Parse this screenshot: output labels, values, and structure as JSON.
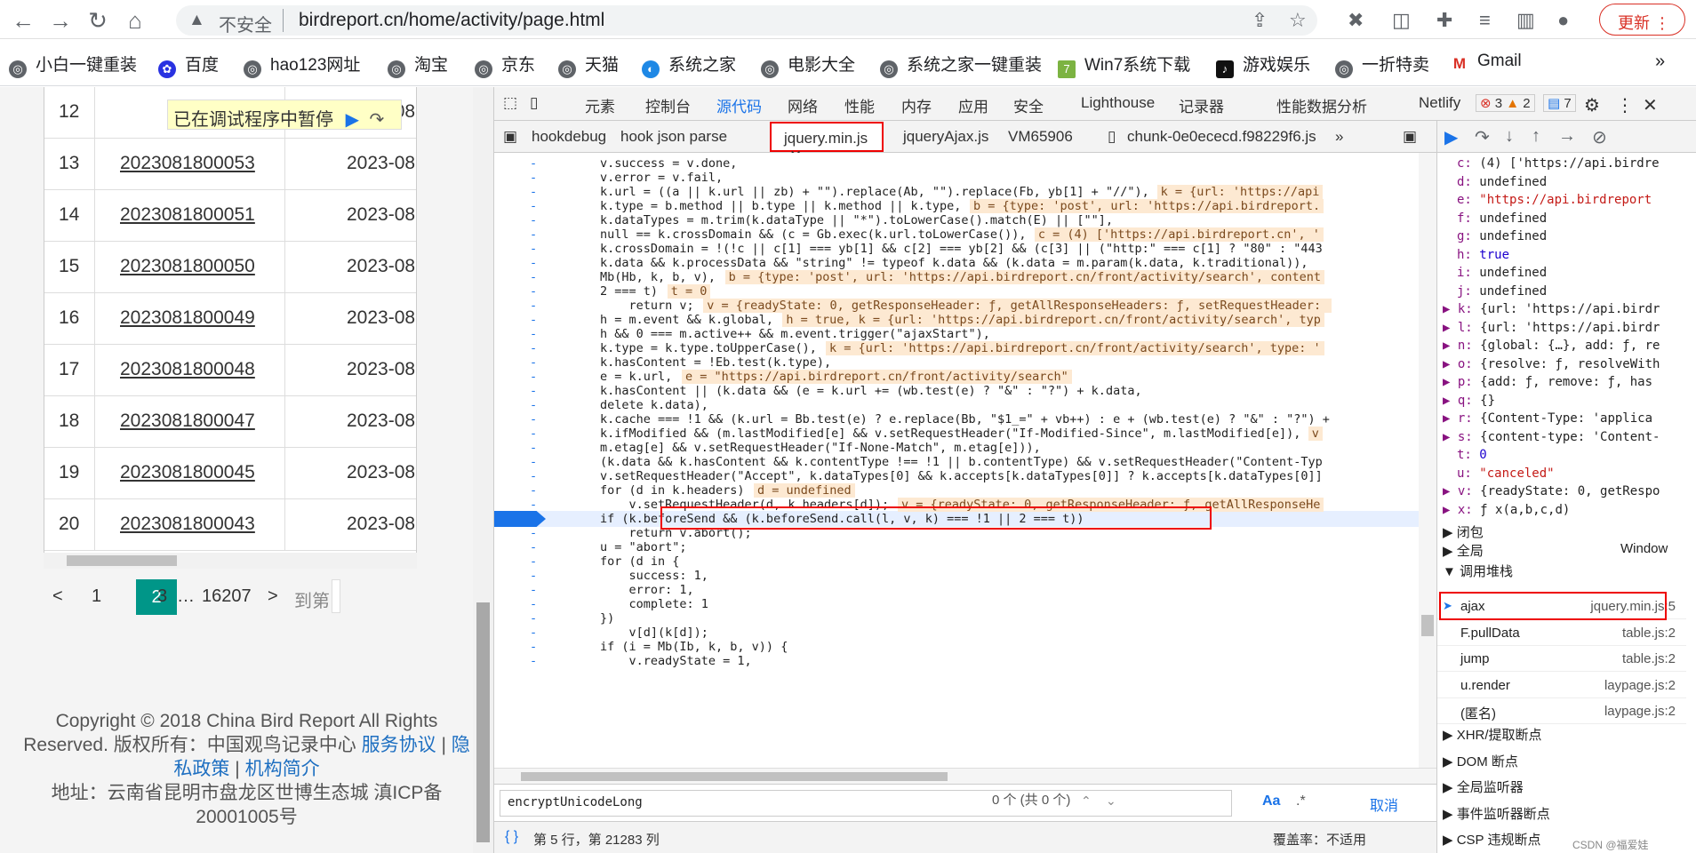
{
  "browser": {
    "url_insecure": "不安全",
    "url": "birdreport.cn/home/activity/page.html",
    "update_label": "更新"
  },
  "bookmarks": [
    "小白一键重装",
    "百度",
    "hao123网址",
    "淘宝",
    "京东",
    "天猫",
    "系统之家",
    "电影大全",
    "系统之家一键重装",
    "Win7系统下载",
    "游戏娱乐",
    "一折特卖",
    "Gmail"
  ],
  "page": {
    "paused_banner": "已在调试程序中暂停",
    "rows": [
      {
        "num": "12",
        "id": "",
        "date": "2023-08"
      },
      {
        "num": "13",
        "id": "2023081800053",
        "date": "2023-08"
      },
      {
        "num": "14",
        "id": "2023081800051",
        "date": "2023-08"
      },
      {
        "num": "15",
        "id": "2023081800050",
        "date": "2023-08"
      },
      {
        "num": "16",
        "id": "2023081800049",
        "date": "2023-08"
      },
      {
        "num": "17",
        "id": "2023081800048",
        "date": "2023-08"
      },
      {
        "num": "18",
        "id": "2023081800047",
        "date": "2023-08"
      },
      {
        "num": "19",
        "id": "2023081800045",
        "date": "2023-08"
      },
      {
        "num": "20",
        "id": "2023081800043",
        "date": "2023-08"
      }
    ],
    "pager": {
      "prev": "<",
      "p1": "1",
      "current": "2",
      "p3": "3",
      "ellipsis": "…",
      "last": "16207",
      "next": ">",
      "goto": "到第"
    },
    "footer": {
      "line1": "Copyright © 2018 China Bird Report All Rights",
      "line2a": "Reserved.   版权所有：中国观鸟记录中心",
      "link1": "服务协议",
      "sep": "|",
      "link2": "隐",
      "link2b": "私政策",
      "link3": "机构简介",
      "line3": "地址：云南省昆明市盘龙区世博生态城     滇ICP备",
      "line4": "20001005号"
    }
  },
  "devtools": {
    "tabs": [
      "元素",
      "控制台",
      "源代码",
      "网络",
      "性能",
      "内存",
      "应用",
      "安全",
      "Lighthouse",
      "记录器",
      "性能数据分析",
      "Netlify"
    ],
    "errors": "3",
    "warnings": "2",
    "messages": "7",
    "source_tabs": [
      "hookdebug",
      "hook json parse",
      "jquery.min.js",
      "jqueryAjax.js",
      "VM65906",
      "chunk-0e0ececd.f98229f6.js"
    ],
    "code_lines": [
      "v.success = v.done,",
      "v.error = v.fail,",
      "k.url = ((a || k.url || zb) + \"\").replace(Ab, \"\").replace(Fb, yb[1] + \"//\"),",
      "k.type = b.method || b.type || k.method || k.type,",
      "k.dataTypes = m.trim(k.dataType || \"*\").toLowerCase().match(E) || [\"\"],",
      "null == k.crossDomain && (c = Gb.exec(k.url.toLowerCase()),",
      "k.crossDomain = !(!c || c[1] === yb[1] && c[2] === yb[2] && (c[3] || (\"http:\" === c[1] ? \"80\" : \"443",
      "k.data && k.processData && \"string\" != typeof k.data && (k.data = m.param(k.data, k.traditional)),",
      "Mb(Hb, k, b, v),",
      "2 === t)",
      "    return v;",
      "h = m.event && k.global,",
      "h && 0 === m.active++ && m.event.trigger(\"ajaxStart\"),",
      "k.type = k.type.toUpperCase(),",
      "k.hasContent = !Eb.test(k.type),",
      "e = k.url,",
      "k.hasContent || (k.data && (e = k.url += (wb.test(e) ? \"&\" : \"?\") + k.data,",
      "delete k.data),",
      "k.cache === !1 && (k.url = Bb.test(e) ? e.replace(Bb, \"$1_=\" + vb++) : e + (wb.test(e) ? \"&\" : \"?\") +",
      "k.ifModified && (m.lastModified[e] && v.setRequestHeader(\"If-Modified-Since\", m.lastModified[e]),",
      "m.etag[e] && v.setRequestHeader(\"If-None-Match\", m.etag[e])),",
      "(k.data && k.hasContent && k.contentType !== !1 || b.contentType) && v.setRequestHeader(\"Content-Typ",
      "v.setRequestHeader(\"Accept\", k.dataTypes[0] && k.accepts[k.dataTypes[0]] ? k.accepts[k.dataTypes[0]]",
      "for (d in k.headers)",
      "    v.setRequestHeader(d, k.headers[d]);",
      "if (k.beforeSend && (k.beforeSend.call(l, v, k) === !1 || 2 === t))",
      "    return v.abort();",
      "u = \"abort\";",
      "for (d in {",
      "    success: 1,",
      "    error: 1,",
      "    complete: 1",
      "})",
      "    v[d](k[d]);",
      "if (i = Mb(Ib, k, b, v)) {",
      "    v.readyState = 1,"
    ],
    "inline_values": [
      {
        "line": 2,
        "text": "k = {url: 'https://api"
      },
      {
        "line": 3,
        "text": "b = {type: 'post', url: 'https://api.birdreport."
      },
      {
        "line": 5,
        "text": "c = (4) ['https://api.birdreport.cn', '"
      },
      {
        "line": 8,
        "text": "b = {type: 'post', url: 'https://api.birdreport.cn/front/activity/search', content"
      },
      {
        "line": 9,
        "text": "t = 0"
      },
      {
        "line": 10,
        "text": "v = {readyState: 0, getResponseHeader: ƒ, getAllResponseHeaders: ƒ, setRequestHeader: "
      },
      {
        "line": 11,
        "text": "h = true, k = {url: 'https://api.birdreport.cn/front/activity/search', typ"
      },
      {
        "line": 13,
        "text": "k = {url: 'https://api.birdreport.cn/front/activity/search', type: '"
      },
      {
        "line": 15,
        "text": "e = \"https://api.birdreport.cn/front/activity/search\""
      },
      {
        "line": 19,
        "text": "v"
      },
      {
        "line": 23,
        "text": "d = undefined"
      },
      {
        "line": 24,
        "text": "v = {readyState: 0, getResponseHeader: ƒ, getAllResponseHe"
      }
    ],
    "search_value": "encryptUnicodeLong",
    "search_count": "0 个 (共 0 个)",
    "search_case": "Aa",
    "search_regex": ".*",
    "search_cancel": "取消",
    "status_pos": "第 5 行，第 21283 列",
    "status_coverage": "覆盖率：不适用",
    "scope_vars": [
      {
        "k": "c:",
        "v": "(4) ['https://api.birdre"
      },
      {
        "k": "d:",
        "v": "undefined"
      },
      {
        "k": "e:",
        "v": "\"https://api.birdreport"
      },
      {
        "k": "f:",
        "v": "undefined"
      },
      {
        "k": "g:",
        "v": "undefined"
      },
      {
        "k": "h:",
        "v": "true"
      },
      {
        "k": "i:",
        "v": "undefined"
      },
      {
        "k": "j:",
        "v": "undefined"
      },
      {
        "k": "▶ k:",
        "v": "{url: 'https://api.birdr"
      },
      {
        "k": "▶ l:",
        "v": "{url: 'https://api.birdr"
      },
      {
        "k": "▶ n:",
        "v": "{global: {…}, add: ƒ, re"
      },
      {
        "k": "▶ o:",
        "v": "{resolve: ƒ, resolveWith"
      },
      {
        "k": "▶ p:",
        "v": "{add: ƒ, remove: ƒ, has"
      },
      {
        "k": "▶ q:",
        "v": "{}"
      },
      {
        "k": "▶ r:",
        "v": "{Content-Type: 'applica"
      },
      {
        "k": "▶ s:",
        "v": "{content-type: 'Content-"
      },
      {
        "k": "t:",
        "v": "0"
      },
      {
        "k": "u:",
        "v": "\"canceled\""
      },
      {
        "k": "▶ v:",
        "v": "{readyState: 0, getRespo"
      },
      {
        "k": "▶ x:",
        "v": "ƒ x(a,b,c,d)"
      }
    ],
    "closure_label": "▶ 闭包",
    "global_label": "▶ 全局",
    "global_value": "Window",
    "callstack_label": "▼ 调用堆栈",
    "callstack": [
      {
        "fn": "ajax",
        "loc": "jquery.min.js:5"
      },
      {
        "fn": "F.pullData",
        "loc": "table.js:2"
      },
      {
        "fn": "jump",
        "loc": "table.js:2"
      },
      {
        "fn": "u.render",
        "loc": "laypage.js:2"
      },
      {
        "fn": "(匿名)",
        "loc": "laypage.js:2"
      }
    ],
    "bp_sections": [
      "▶ XHR/提取断点",
      "▶ DOM 断点",
      "▶ 全局监听器",
      "▶ 事件监听器断点",
      "▶ CSP 违规断点"
    ],
    "watermark": "CSDN @福爱娃"
  }
}
